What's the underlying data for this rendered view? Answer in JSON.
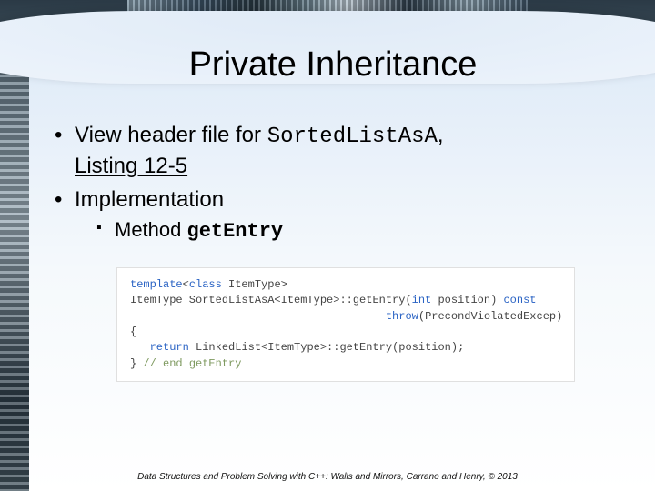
{
  "title": "Private Inheritance",
  "bullets": {
    "b1_pre": "View header file for ",
    "b1_code": "SortedListAsA",
    "b1_post": ", ",
    "b1_link": "Listing 12-5",
    "b2": "Implementation",
    "sub1_pre": "Method ",
    "sub1_code": "getEntry"
  },
  "code": {
    "l1a": "template",
    "l1b": "<",
    "l1c": "class",
    "l1d": " ItemType>",
    "l2a": "ItemType SortedListAsA<ItemType>::getEntry(",
    "l2b": "int",
    "l2c": " position) ",
    "l2d": "const",
    "l3a": "                                       ",
    "l3b": "throw",
    "l3c": "(PrecondViolatedExcep)",
    "l4": "{",
    "l5a": "   ",
    "l5b": "return",
    "l5c": " LinkedList<ItemType>::getEntry(position);",
    "l6a": "} ",
    "l6b": "// end getEntry"
  },
  "footer": "Data Structures and Problem Solving with C++: Walls and Mirrors, Carrano and Henry, ©  2013"
}
